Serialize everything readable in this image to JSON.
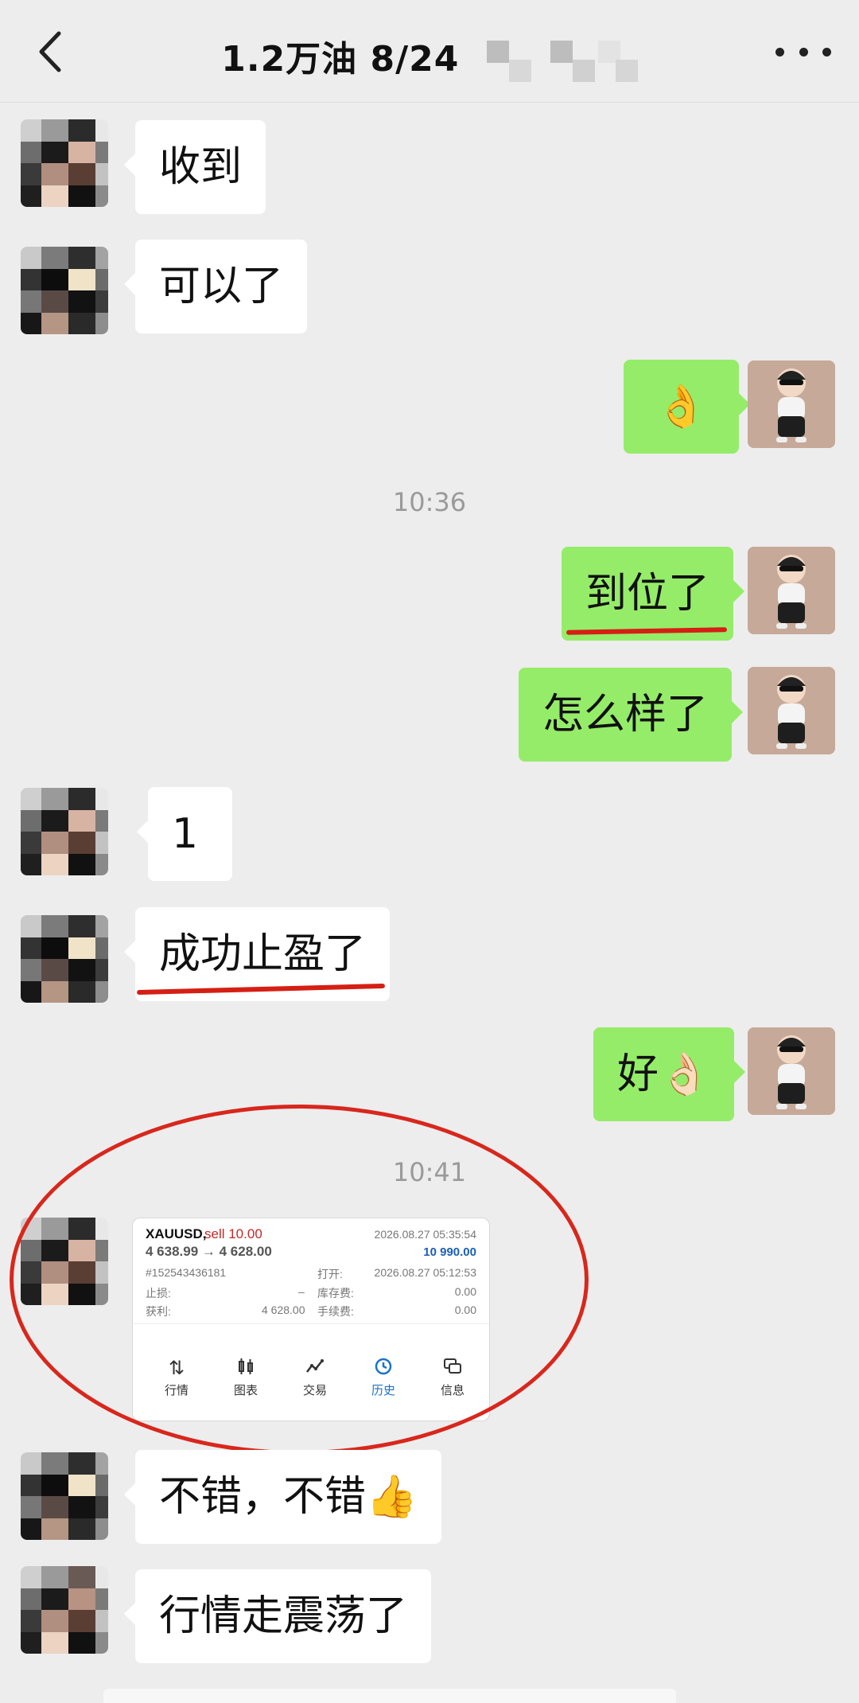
{
  "header": {
    "title": "1.2万油  8/24",
    "back_icon": "chevron-left-icon",
    "more_icon": "more-dots-icon"
  },
  "colors": {
    "self_bubble": "#95ec69",
    "other_bubble": "#ffffff",
    "background": "#ededed",
    "annotation": "#d51f14"
  },
  "messages": [
    {
      "text": "收到"
    },
    {
      "text": "可以了"
    },
    {
      "text": "👌"
    },
    {
      "text": "到位了"
    },
    {
      "text": "怎么样了"
    },
    {
      "text": "1"
    },
    {
      "text": "成功止盈了"
    },
    {
      "text": "好👌🏻"
    },
    {
      "text": "不错，不错👍"
    },
    {
      "text": "行情走震荡了"
    }
  ],
  "timestamps": [
    "10:36",
    "10:41"
  ],
  "trade_card": {
    "symbol": "XAUUSD,",
    "side": "sell 10.00",
    "close_time": "2026.08.27 05:35:54",
    "prices": "4 638.99 → 4 628.00",
    "profit": "10 990.00",
    "order_id": "#152543436181",
    "open_label": "打开:",
    "open_time": "2026.08.27 05:12:53",
    "sl_label": "止损:",
    "sl_value": "–",
    "swap_label": "库存费:",
    "swap_value": "0.00",
    "tp_label": "获利:",
    "tp_value": "4 628.00",
    "fee_label": "手续费:",
    "fee_value": "0.00",
    "tabs": [
      {
        "label": "行情",
        "icon": "arrows-updown-icon"
      },
      {
        "label": "图表",
        "icon": "candlestick-icon"
      },
      {
        "label": "交易",
        "icon": "trade-line-icon"
      },
      {
        "label": "历史",
        "icon": "history-clock-icon"
      },
      {
        "label": "信息",
        "icon": "chat-bubbles-icon"
      }
    ],
    "active_tab": "历史"
  }
}
